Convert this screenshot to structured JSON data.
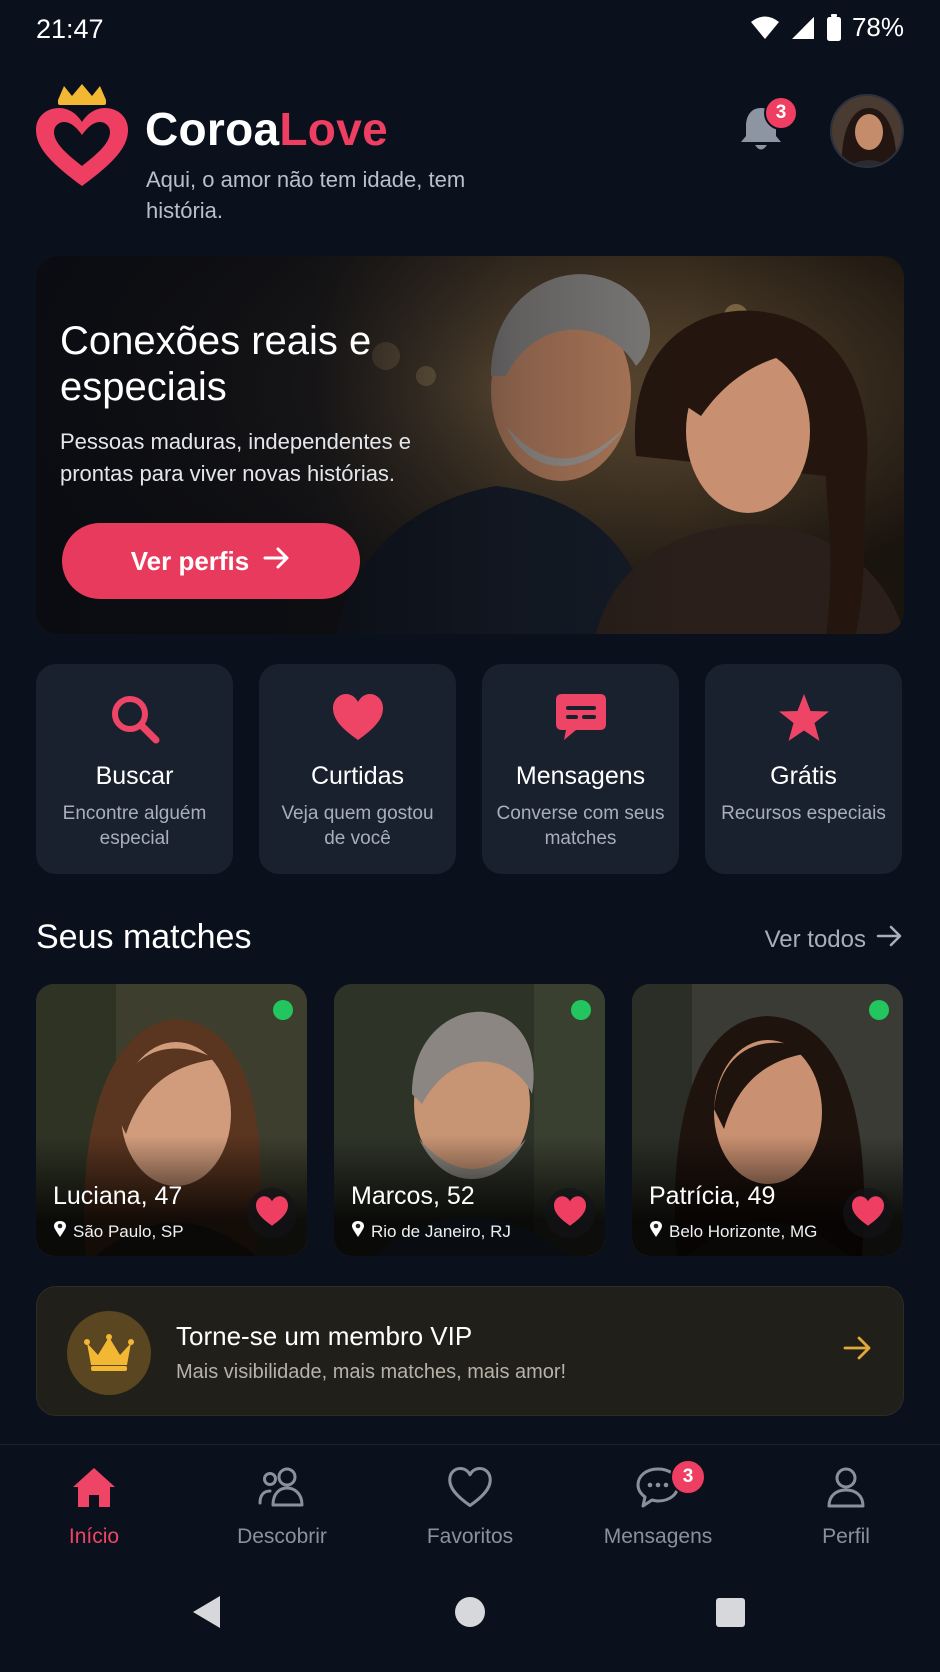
{
  "status_bar": {
    "time": "21:47",
    "battery": "78%",
    "icons": [
      "wifi-icon",
      "signal-icon",
      "battery-icon"
    ]
  },
  "header": {
    "brand_part1": "Coroa",
    "brand_part2": "Love",
    "tagline": "Aqui, o amor não tem idade, tem história.",
    "notification_count": "3",
    "colors": {
      "accent": "#ee3e62",
      "crown": "#f2b733"
    }
  },
  "hero": {
    "title": "Conexões reais e especiais",
    "subtitle": "Pessoas maduras, independentes e prontas para viver novas histórias.",
    "button_label": "Ver perfis"
  },
  "quick_actions": [
    {
      "title": "Buscar",
      "desc": "Encontre alguém especial",
      "icon": "search-icon"
    },
    {
      "title": "Curtidas",
      "desc": "Veja quem gostou de você",
      "icon": "heart-icon"
    },
    {
      "title": "Mensagens",
      "desc": "Converse com seus matches",
      "icon": "chat-icon"
    },
    {
      "title": "Grátis",
      "desc": "Recursos especiais",
      "icon": "star-icon"
    }
  ],
  "matches": {
    "section_title": "Seus matches",
    "see_all": "Ver todos",
    "items": [
      {
        "name": "Luciana, 47",
        "location": "São Paulo, SP",
        "online": true
      },
      {
        "name": "Marcos, 52",
        "location": "Rio de Janeiro, RJ",
        "online": true
      },
      {
        "name": "Patrícia, 49",
        "location": "Belo Horizonte, MG",
        "online": true
      }
    ]
  },
  "vip": {
    "title": "Torne-se um membro VIP",
    "subtitle": "Mais visibilidade, mais matches, mais amor!"
  },
  "bottom_nav": {
    "items": [
      {
        "label": "Início",
        "icon": "home-icon",
        "active": true
      },
      {
        "label": "Descobrir",
        "icon": "people-icon",
        "active": false
      },
      {
        "label": "Favoritos",
        "icon": "heart-outline-icon",
        "active": false
      },
      {
        "label": "Mensagens",
        "icon": "chat-outline-icon",
        "active": false,
        "badge": "3"
      },
      {
        "label": "Perfil",
        "icon": "user-icon",
        "active": false
      }
    ]
  }
}
